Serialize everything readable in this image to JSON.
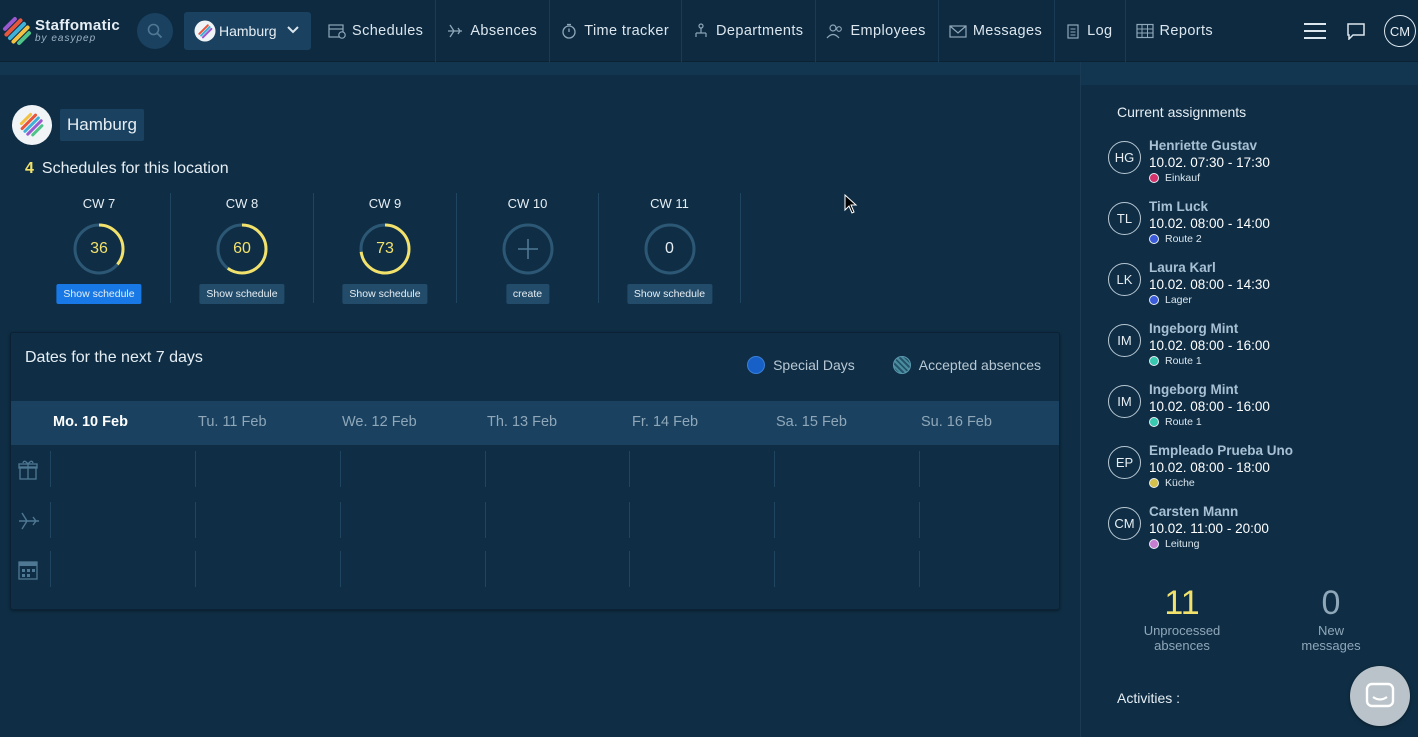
{
  "brand": {
    "name": "Staffomatic",
    "sub": "by easypep"
  },
  "location_select": {
    "label": "Hamburg"
  },
  "nav": [
    {
      "label": "Schedules",
      "icon": "schedule-icon"
    },
    {
      "label": "Absences",
      "icon": "plane-icon"
    },
    {
      "label": "Time tracker",
      "icon": "stopwatch-icon"
    },
    {
      "label": "Departments",
      "icon": "departments-icon"
    },
    {
      "label": "Employees",
      "icon": "employees-icon"
    },
    {
      "label": "Messages",
      "icon": "envelope-icon"
    },
    {
      "label": "Log",
      "icon": "clipboard-icon"
    },
    {
      "label": "Reports",
      "icon": "table-icon"
    }
  ],
  "user": {
    "initials": "CM"
  },
  "location": {
    "name": "Hamburg",
    "schedule_count": "4",
    "schedule_text": "Schedules for this location"
  },
  "weeks": [
    {
      "cw": "CW 7",
      "value": "36",
      "fill": 0.36,
      "button": "Show schedule",
      "primary": true
    },
    {
      "cw": "CW 8",
      "value": "60",
      "fill": 0.6,
      "button": "Show schedule",
      "primary": false
    },
    {
      "cw": "CW 9",
      "value": "73",
      "fill": 0.73,
      "button": "Show schedule",
      "primary": false
    },
    {
      "cw": "CW 10",
      "value": "",
      "fill": 0,
      "button": "create",
      "primary": false,
      "plus": true
    },
    {
      "cw": "CW 11",
      "value": "0",
      "fill": 0,
      "button": "Show schedule",
      "primary": false
    }
  ],
  "dates": {
    "title": "Dates for the next 7 days",
    "legend": {
      "special": "Special Days",
      "absences": "Accepted absences"
    },
    "days": [
      "Mo. 10 Feb",
      "Tu. 11 Feb",
      "We. 12 Feb",
      "Th. 13 Feb",
      "Fr. 14 Feb",
      "Sa. 15 Feb",
      "Su. 16 Feb"
    ]
  },
  "side": {
    "title": "Current assignments",
    "assignments": [
      {
        "initials": "HG",
        "name": "Henriette Gustav",
        "time": "10.02. 07:30 - 17:30",
        "dept": "Einkauf",
        "color": "#d6336c"
      },
      {
        "initials": "TL",
        "name": "Tim Luck",
        "time": "10.02. 08:00 - 14:00",
        "dept": "Route 2",
        "color": "#3b5bdb"
      },
      {
        "initials": "LK",
        "name": "Laura Karl",
        "time": "10.02. 08:00 - 14:30",
        "dept": "Lager",
        "color": "#3b5bdb"
      },
      {
        "initials": "IM",
        "name": "Ingeborg Mint",
        "time": "10.02. 08:00 - 16:00",
        "dept": "Route 1",
        "color": "#38c9b0"
      },
      {
        "initials": "IM",
        "name": "Ingeborg Mint",
        "time": "10.02. 08:00 - 16:00",
        "dept": "Route 1",
        "color": "#38c9b0"
      },
      {
        "initials": "EP",
        "name": "Empleado Prueba Uno",
        "time": "10.02. 08:00 - 18:00",
        "dept": "Küche",
        "color": "#d4c04a"
      },
      {
        "initials": "CM",
        "name": "Carsten Mann",
        "time": "10.02. 11:00 - 20:00",
        "dept": "Leitung",
        "color": "#c77dd0"
      }
    ],
    "stats": {
      "unprocessed": {
        "value": "11",
        "label1": "Unprocessed",
        "label2": "absences"
      },
      "messages": {
        "value": "0",
        "label1": "New",
        "label2": "messages"
      }
    },
    "activities": "Activities :"
  }
}
